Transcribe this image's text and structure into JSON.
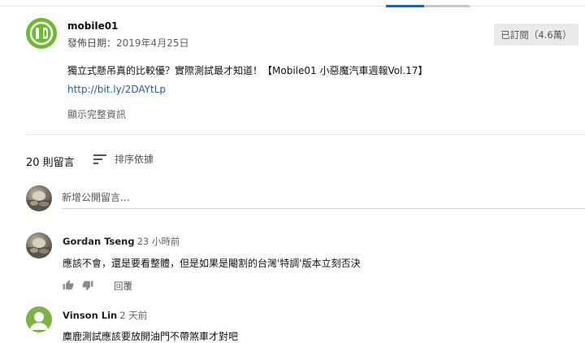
{
  "channel": {
    "name": "mobile01",
    "date_label": "發佈日期：",
    "date_value": "2019年4月25日",
    "subscribe_label": "已訂閱（4.6萬）"
  },
  "description": {
    "title": "獨立式懸吊真的比較優？實際測試最才知道！【Mobile01 小惡魔汽車週報Vol.17】",
    "link": "http://bit.ly/2DAYtLp",
    "show_more": "顯示完整資訊"
  },
  "comments_header": {
    "count": "20 則留言",
    "sort_label": "排序依據"
  },
  "add_comment": {
    "placeholder": "新增公開留言..."
  },
  "comments": [
    {
      "author": "Gordan Tseng",
      "time": "23 小時前",
      "text": "應該不會，還是要看整體，但是如果是閹割的台灣'特調'版本立刻否決",
      "reply_label": "回覆"
    },
    {
      "author": "Vinson Lin",
      "time": "2 天前",
      "text": "麋鹿測試應該要放開油門不帶煞車才對吧",
      "reply_label": ""
    }
  ],
  "colors": {
    "accent": "#1e63a8",
    "link": "#1a5fb4",
    "channel_avatar": "#6cba2d",
    "vinson_avatar": "#7cb342"
  },
  "icons": {
    "like": "thumbs-up-icon",
    "dislike": "thumbs-down-icon",
    "sort": "sort-lines-icon"
  }
}
